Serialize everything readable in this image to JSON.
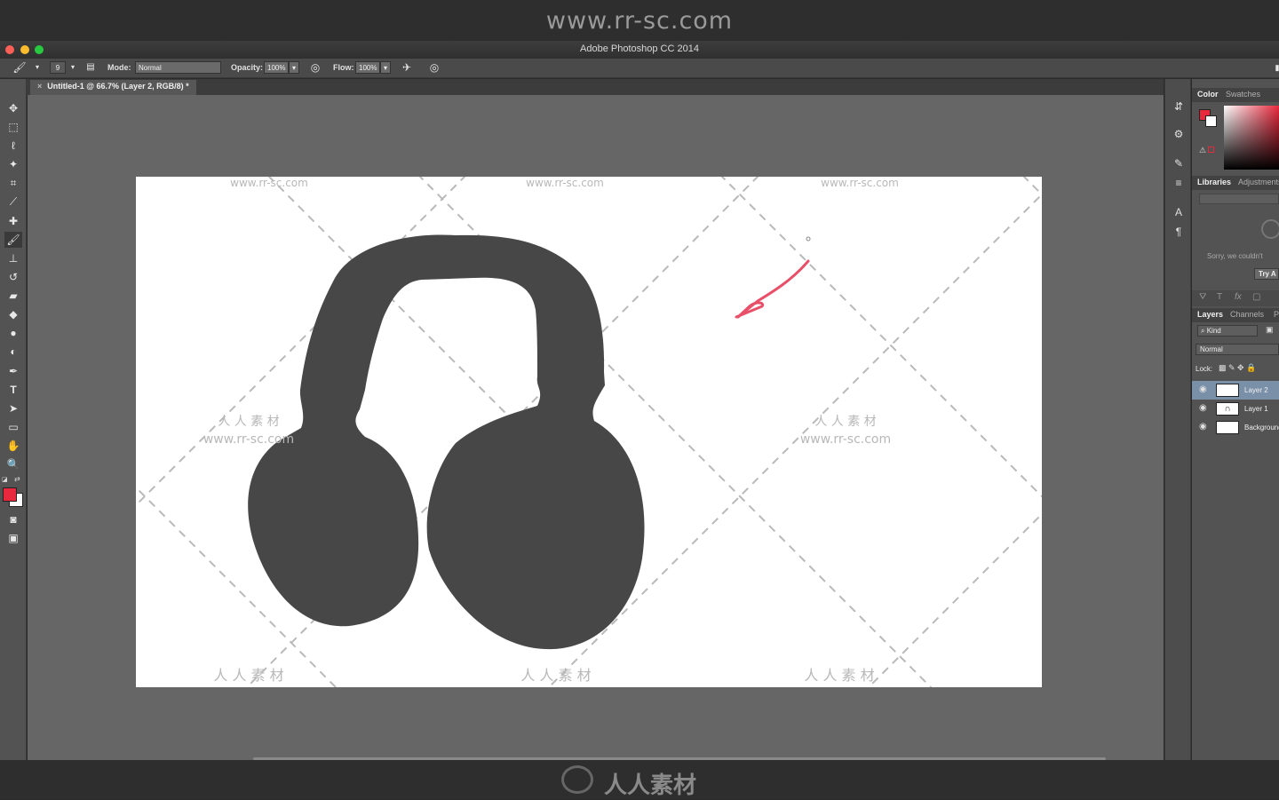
{
  "watermark": {
    "url": "www.rr-sc.com",
    "cn": "人 人 素 材",
    "bottom": "人人素材"
  },
  "window": {
    "title": "Adobe Photoshop CC 2014"
  },
  "options": {
    "brush_size": "9",
    "mode_label": "Mode:",
    "mode_value": "Normal",
    "opacity_label": "Opacity:",
    "opacity_value": "100%",
    "flow_label": "Flow:",
    "flow_value": "100%"
  },
  "document": {
    "tab_label": "Untitled-1 @ 66.7% (Layer 2, RGB/8) *",
    "close": "×"
  },
  "toolbar": {
    "tools": [
      "move-tool",
      "marquee-tool",
      "lasso-tool",
      "quick-select-tool",
      "crop-tool",
      "eyedropper-tool",
      "healing-brush-tool",
      "brush-tool",
      "clone-stamp-tool",
      "history-brush-tool",
      "eraser-tool",
      "paint-bucket-tool",
      "blur-tool",
      "dodge-tool",
      "pen-tool",
      "type-tool",
      "path-select-tool",
      "shape-tool",
      "hand-tool",
      "zoom-tool"
    ],
    "foreground_color": "#e8283c",
    "background_color": "#ffffff"
  },
  "colors": {
    "canvas_bg": "#666666",
    "ui_panel": "#535353",
    "headphone": "#474747",
    "stroke": "#e8506a"
  },
  "panels": {
    "color_tabs": [
      "Color",
      "Swatches"
    ],
    "library_tabs": [
      "Libraries",
      "Adjustments"
    ],
    "library_message": "Sorry, we couldn't",
    "library_try": "Try A",
    "layer_tabs": [
      "Layers",
      "Channels",
      "P"
    ],
    "kind_filter": "Kind",
    "blend_mode": "Normal",
    "lock_label": "Lock:",
    "layers": [
      {
        "name": "Layer 2",
        "selected": true
      },
      {
        "name": "Layer 1",
        "selected": false
      },
      {
        "name": "Background",
        "selected": false
      }
    ]
  }
}
